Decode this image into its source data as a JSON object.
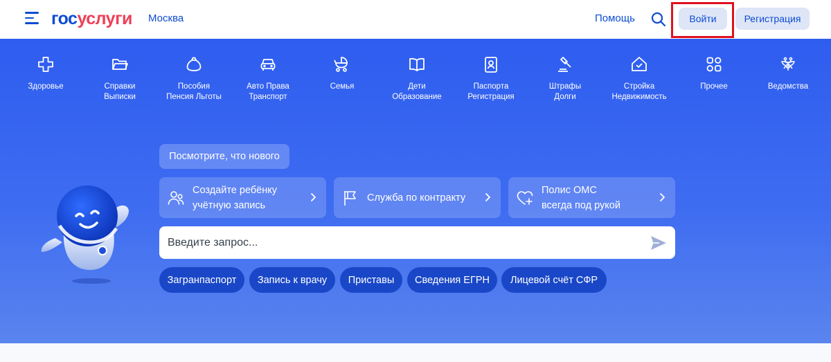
{
  "header": {
    "logo_part1": "гос",
    "logo_part2": "услуги",
    "city": "Москва",
    "help": "Помощь",
    "login": "Войти",
    "register": "Регистрация"
  },
  "categories": [
    {
      "line1": "Здоровье",
      "line2": "",
      "icon": "health-icon"
    },
    {
      "line1": "Справки",
      "line2": "Выписки",
      "icon": "folder-icon"
    },
    {
      "line1": "Пособия",
      "line2": "Пенсия Льготы",
      "icon": "moneybag-icon"
    },
    {
      "line1": "Авто Права",
      "line2": "Транспорт",
      "icon": "car-icon"
    },
    {
      "line1": "Семья",
      "line2": "",
      "icon": "stroller-icon"
    },
    {
      "line1": "Дети",
      "line2": "Образование",
      "icon": "book-icon"
    },
    {
      "line1": "Паспорта",
      "line2": "Регистрация",
      "icon": "passport-icon"
    },
    {
      "line1": "Штрафы",
      "line2": "Долги",
      "icon": "gavel-icon"
    },
    {
      "line1": "Стройка",
      "line2": "Недвижимость",
      "icon": "house-icon"
    },
    {
      "line1": "Прочее",
      "line2": "",
      "icon": "grid-icon"
    },
    {
      "line1": "Ведомства",
      "line2": "",
      "icon": "emblem-icon"
    }
  ],
  "news": {
    "label": "Посмотрите, что нового"
  },
  "cards": [
    {
      "line1": "Создайте ребёнку",
      "line2": "учётную запись",
      "icon": "people-icon"
    },
    {
      "line1": "Служба по контракту",
      "line2": "",
      "icon": "flag-icon"
    },
    {
      "line1": "Полис ОМС",
      "line2": "всегда под рукой",
      "icon": "heart-plus-icon"
    }
  ],
  "search": {
    "placeholder": "Введите запрос..."
  },
  "chips": [
    "Загранпаспорт",
    "Запись к врачу",
    "Приставы",
    "Сведения ЕГРН",
    "Лицевой счёт СФР"
  ],
  "colors": {
    "brand_blue": "#0d4cd3",
    "brand_red": "#ee3f58",
    "hero": "#3a67f0",
    "login_highlight": "#e0101e"
  }
}
